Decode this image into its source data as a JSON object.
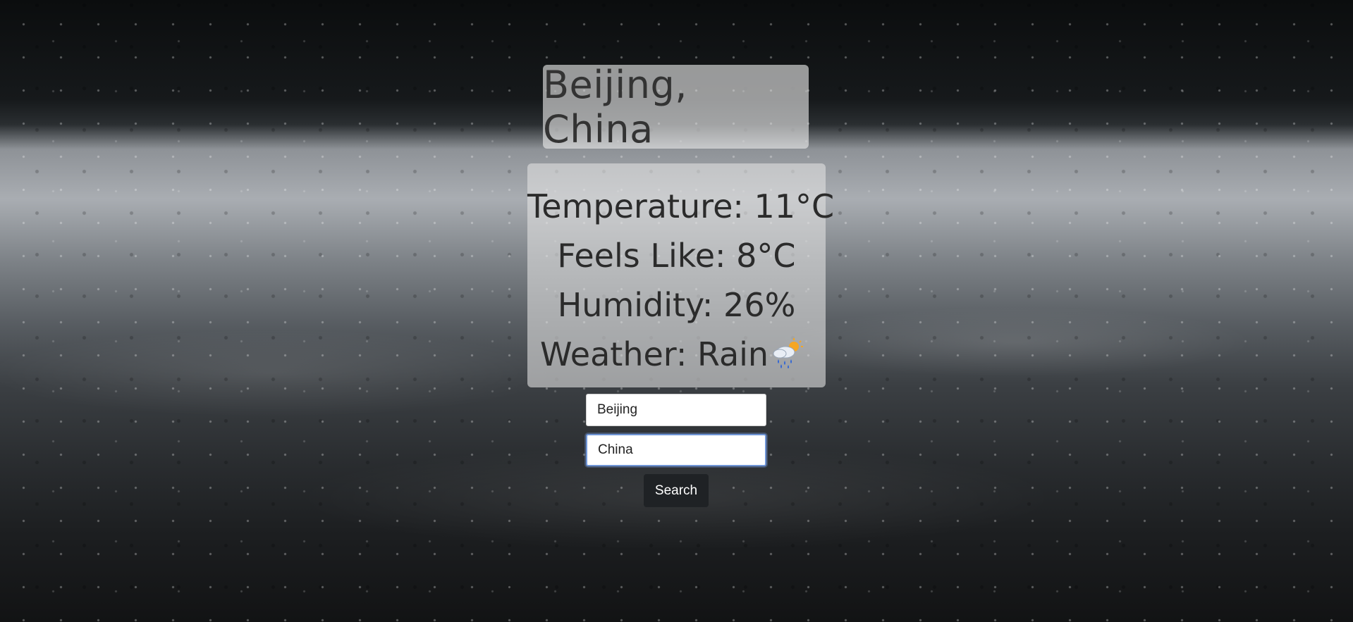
{
  "location": {
    "title": "Beijing, China"
  },
  "weather": {
    "temperature": "Temperature: 11°C",
    "feels_like": "Feels Like: 8°C",
    "humidity": "Humidity: 26%",
    "condition": "Weather: Rain",
    "icon": "rain-sun-icon"
  },
  "form": {
    "city_value": "Beijing",
    "country_value": "China",
    "search_label": "Search"
  },
  "colors": {
    "button_bg": "#1f2225",
    "focus_ring": "#6f95d6"
  }
}
